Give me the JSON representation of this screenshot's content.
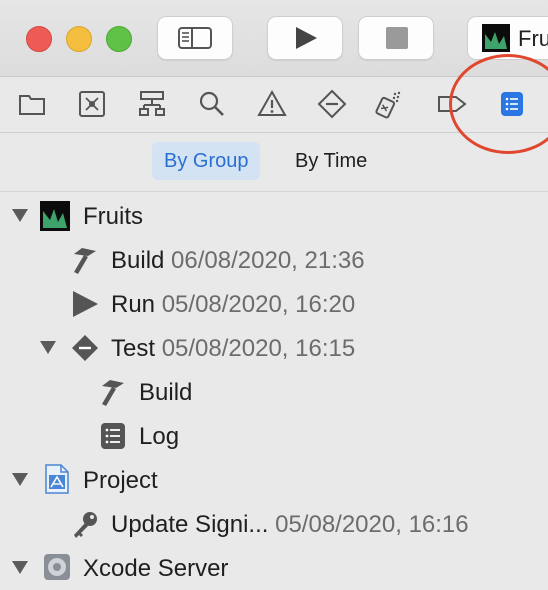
{
  "window": {
    "scheme_name": "Fru"
  },
  "navigator": {
    "icons": [
      "project-navigator-icon",
      "source-control-icon",
      "symbol-navigator-icon",
      "find-navigator-icon",
      "issue-navigator-icon",
      "test-navigator-icon",
      "debug-navigator-icon",
      "breakpoint-navigator-icon",
      "report-navigator-icon"
    ],
    "active": "report-navigator-icon"
  },
  "segments": {
    "by_group": "By Group",
    "by_time": "By Time"
  },
  "tree": {
    "fruits": {
      "label": "Fruits"
    },
    "build1": {
      "label": "Build",
      "date": "06/08/2020, 21:36"
    },
    "run1": {
      "label": "Run",
      "date": "05/08/2020, 16:20"
    },
    "test1": {
      "label": "Test",
      "date": "05/08/2020, 16:15"
    },
    "test_build": {
      "label": "Build"
    },
    "test_log": {
      "label": "Log"
    },
    "project": {
      "label": "Project"
    },
    "update_signing": {
      "label": "Update Signi...",
      "date": "05/08/2020, 16:16"
    },
    "xcode_server": {
      "label": "Xcode Server"
    }
  },
  "colors": {
    "accent": "#2a6fd2",
    "callout": "#e0472f"
  }
}
